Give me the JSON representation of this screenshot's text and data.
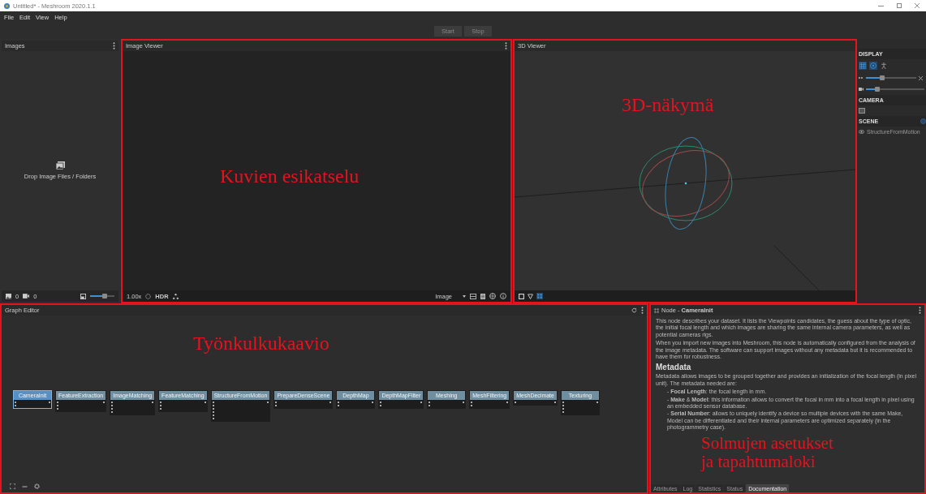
{
  "window": {
    "title": "Untitled* - Meshroom 2020.1.1"
  },
  "menu": [
    "File",
    "Edit",
    "View",
    "Help"
  ],
  "toolbar": {
    "buttons": [
      {
        "label": "Start",
        "disabled": true
      },
      {
        "label": "Stop",
        "disabled": true
      }
    ]
  },
  "images_panel": {
    "title": "Images",
    "highlighted": false,
    "drop_hint": "Drop Image Files / Folders",
    "image_count": "0",
    "camera_count": "0",
    "thumbnail_size": {
      "level": 0.6
    }
  },
  "image_viewer": {
    "title": "Image Viewer",
    "highlighted": true,
    "annotation": "Kuvien esikatselu",
    "zoom": "1.00x",
    "hdr": "HDR",
    "channel": "Image"
  },
  "viewer_3d": {
    "title": "3D Viewer",
    "highlighted": true,
    "annotation": "3D-näkymä"
  },
  "side_panel": {
    "display": {
      "title": "DISPLAY",
      "toggles": [
        {
          "kind": "grid",
          "on": true
        },
        {
          "kind": "gizmo",
          "on": true
        },
        {
          "kind": "origin",
          "on": false
        }
      ],
      "point_size": {
        "level": 0.32
      },
      "camera_scale": {
        "level": 0.2
      }
    },
    "camera": {
      "title": "CAMERA"
    },
    "scene": {
      "title": "SCENE",
      "items": [
        "StructureFromMotion"
      ]
    }
  },
  "graph_editor": {
    "title": "Graph Editor",
    "highlighted": true,
    "annotation": "Työnkulkukaavio",
    "nodes": [
      {
        "name": "CameraInit",
        "selected": true
      },
      {
        "name": "FeatureExtraction",
        "selected": false
      },
      {
        "name": "ImageMatching",
        "selected": false
      },
      {
        "name": "FeatureMatching",
        "selected": false
      },
      {
        "name": "StructureFromMotion",
        "selected": false
      },
      {
        "name": "PrepareDenseScene",
        "selected": false
      },
      {
        "name": "DepthMap",
        "selected": false
      },
      {
        "name": "DepthMapFilter",
        "selected": false
      },
      {
        "name": "Meshing",
        "selected": false
      },
      {
        "name": "MeshFiltering",
        "selected": false
      },
      {
        "name": "MeshDecimate",
        "selected": false
      },
      {
        "name": "Texturing",
        "selected": false
      }
    ]
  },
  "node_panel": {
    "title": "Node - **CameraInit**",
    "highlighted": true,
    "annotation": [
      "Solmujen asetukset",
      "ja tapahtumaloki"
    ],
    "paragraphs": [
      "This node describes your dataset. It lists the Viewpoints candidates, the guess about the type of optic, the initial focal length and which images are sharing the same internal camera parameters, as well as potential cameras rigs.",
      "When you import new images into Meshroom, this node is automatically configured from the analysis of the image metadata. The software can support images without any metadata but it is recommended to have them for robustness."
    ],
    "heading": "Metadata",
    "intro": "Metadata allows images to be grouped together and provides an initialization of the focal length (in pixel unit). The metadata needed are:",
    "bullets": [
      "- **Focal Length**: the focal length in mm.",
      "- **Make** & **Model**: this information allows to convert the focal in mm into a focal length in pixel using an embedded sensor database.",
      "- **Serial Number**: allows to uniquely identify a device so multiple devices with the same Make, Model can be differentiated and their internal parameters are optimized separately (in the photogrammetry case)."
    ],
    "tabs": [
      {
        "label": "Attributes",
        "selected": false
      },
      {
        "label": "Log",
        "selected": false
      },
      {
        "label": "Statistics",
        "selected": false
      },
      {
        "label": "Status",
        "selected": false
      },
      {
        "label": "Documentation",
        "selected": true
      }
    ]
  }
}
